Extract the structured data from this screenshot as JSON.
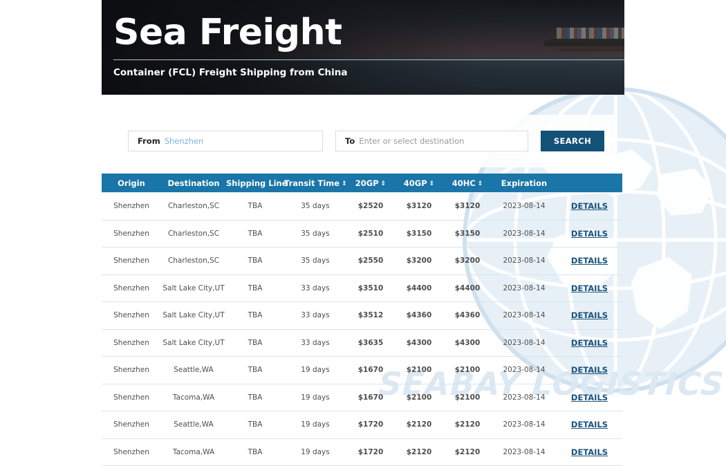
{
  "banner": {
    "title": "Sea Freight",
    "subtitle": "Container (FCL) Freight Shipping from China",
    "photo_alt": "container-ship-photo"
  },
  "watermark": {
    "wordmark": "SEABAY LOGISTICS",
    "globe": "globe-watermark"
  },
  "search": {
    "from_label": "From",
    "from_value": "Shenzhen",
    "to_label": "To",
    "to_placeholder": "Enter or select destination",
    "button_label": "SEARCH"
  },
  "table": {
    "columns": [
      {
        "label": "Origin",
        "sortable": false
      },
      {
        "label": "Destination",
        "sortable": false
      },
      {
        "label": "Shipping Line",
        "sortable": false
      },
      {
        "label": "Transit Time",
        "sortable": true
      },
      {
        "label": "20GP",
        "sortable": true
      },
      {
        "label": "40GP",
        "sortable": true
      },
      {
        "label": "40HC",
        "sortable": true
      },
      {
        "label": "Expiration",
        "sortable": false
      },
      {
        "label": "",
        "sortable": false
      }
    ],
    "sort_glyph": "⇕",
    "details_label": "DETAILS",
    "rows": [
      {
        "origin": "Shenzhen",
        "destination": "Charleston,SC",
        "line": "TBA",
        "transit": "35 days",
        "gp20": "$2520",
        "gp40": "$3120",
        "hc40": "$3120",
        "expiration": "2023-08-14",
        "details": "DETAILS"
      },
      {
        "origin": "Shenzhen",
        "destination": "Charleston,SC",
        "line": "TBA",
        "transit": "35 days",
        "gp20": "$2510",
        "gp40": "$3150",
        "hc40": "$3150",
        "expiration": "2023-08-14",
        "details": "DETAILS"
      },
      {
        "origin": "Shenzhen",
        "destination": "Charleston,SC",
        "line": "TBA",
        "transit": "35 days",
        "gp20": "$2550",
        "gp40": "$3200",
        "hc40": "$3200",
        "expiration": "2023-08-14",
        "details": "DETAILS"
      },
      {
        "origin": "Shenzhen",
        "destination": "Salt Lake City,UT",
        "line": "TBA",
        "transit": "33 days",
        "gp20": "$3510",
        "gp40": "$4400",
        "hc40": "$4400",
        "expiration": "2023-08-14",
        "details": "DETAILS"
      },
      {
        "origin": "Shenzhen",
        "destination": "Salt Lake City,UT",
        "line": "TBA",
        "transit": "33 days",
        "gp20": "$3512",
        "gp40": "$4360",
        "hc40": "$4360",
        "expiration": "2023-08-14",
        "details": "DETAILS"
      },
      {
        "origin": "Shenzhen",
        "destination": "Salt Lake City,UT",
        "line": "TBA",
        "transit": "33 days",
        "gp20": "$3635",
        "gp40": "$4300",
        "hc40": "$4300",
        "expiration": "2023-08-14",
        "details": "DETAILS"
      },
      {
        "origin": "Shenzhen",
        "destination": "Seattle,WA",
        "line": "TBA",
        "transit": "19 days",
        "gp20": "$1670",
        "gp40": "$2100",
        "hc40": "$2100",
        "expiration": "2023-08-14",
        "details": "DETAILS"
      },
      {
        "origin": "Shenzhen",
        "destination": "Tacoma,WA",
        "line": "TBA",
        "transit": "19 days",
        "gp20": "$1670",
        "gp40": "$2100",
        "hc40": "$2100",
        "expiration": "2023-08-14",
        "details": "DETAILS"
      },
      {
        "origin": "Shenzhen",
        "destination": "Seattle,WA",
        "line": "TBA",
        "transit": "19 days",
        "gp20": "$1720",
        "gp40": "$2120",
        "hc40": "$2120",
        "expiration": "2023-08-14",
        "details": "DETAILS"
      },
      {
        "origin": "Shenzhen",
        "destination": "Tacoma,WA",
        "line": "TBA",
        "transit": "19 days",
        "gp20": "$1720",
        "gp40": "$2120",
        "hc40": "$2120",
        "expiration": "2023-08-14",
        "details": "DETAILS"
      }
    ]
  },
  "colors": {
    "table_header_blue": "#1a75a8",
    "search_button_blue": "#145177",
    "price_blue": "#2e9ae0",
    "details_blue": "#18527e",
    "from_value_blue": "#7fb4e0",
    "row_divider": "#d7e6ef",
    "watermark_blue": "#dce8f2"
  }
}
